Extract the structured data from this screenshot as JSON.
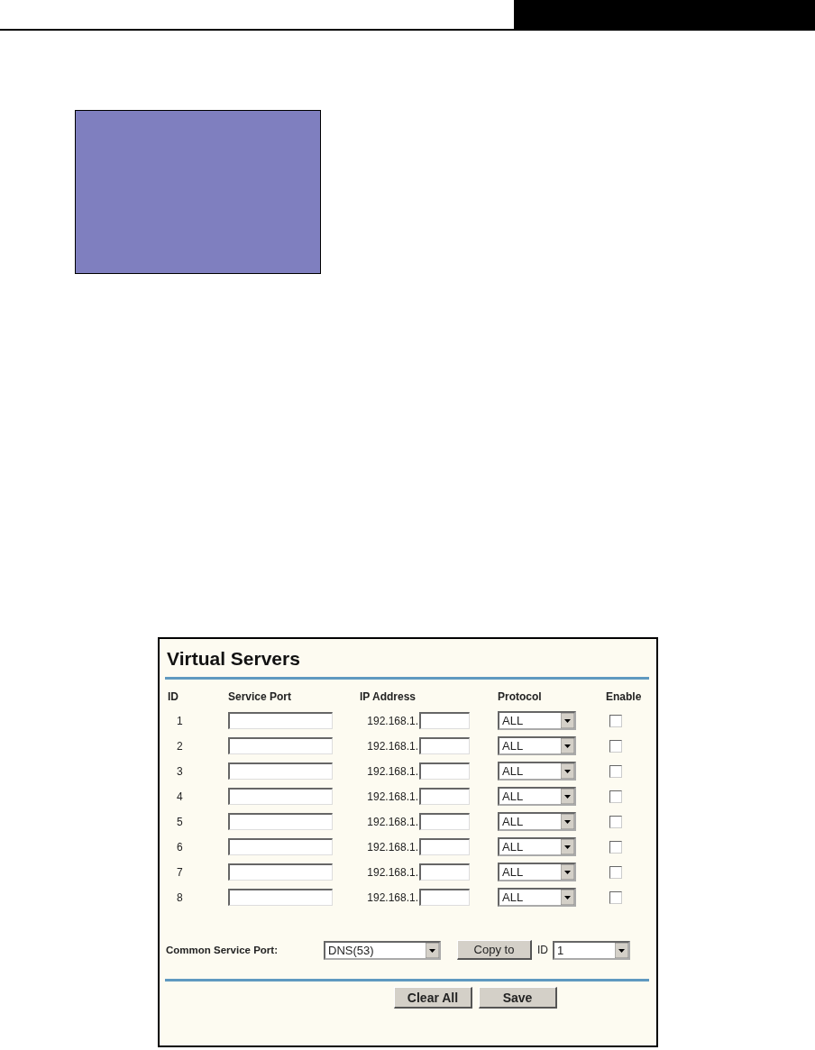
{
  "panel": {
    "title": "Virtual Servers",
    "columns": [
      "ID",
      "Service Port",
      "IP Address",
      "Protocol",
      "Enable"
    ],
    "rows": [
      {
        "id": "1",
        "service_port": "",
        "ip_prefix": "192.168.1.",
        "protocol": "ALL",
        "enabled": false
      },
      {
        "id": "2",
        "service_port": "",
        "ip_prefix": "192.168.1.",
        "protocol": "ALL",
        "enabled": false
      },
      {
        "id": "3",
        "service_port": "",
        "ip_prefix": "192.168.1.",
        "protocol": "ALL",
        "enabled": false
      },
      {
        "id": "4",
        "service_port": "",
        "ip_prefix": "192.168.1.",
        "protocol": "ALL",
        "enabled": false
      },
      {
        "id": "5",
        "service_port": "",
        "ip_prefix": "192.168.1.",
        "protocol": "ALL",
        "enabled": false
      },
      {
        "id": "6",
        "service_port": "",
        "ip_prefix": "192.168.1.",
        "protocol": "ALL",
        "enabled": false
      },
      {
        "id": "7",
        "service_port": "",
        "ip_prefix": "192.168.1.",
        "protocol": "ALL",
        "enabled": false
      },
      {
        "id": "8",
        "service_port": "",
        "ip_prefix": "192.168.1.",
        "protocol": "ALL",
        "enabled": false
      }
    ],
    "common_service_port": {
      "label": "Common Service Port:",
      "value": "DNS(53)"
    },
    "copy_button": "Copy to",
    "id_label": "ID",
    "id_select": "1",
    "buttons": [
      "Clear All",
      "Save"
    ]
  }
}
